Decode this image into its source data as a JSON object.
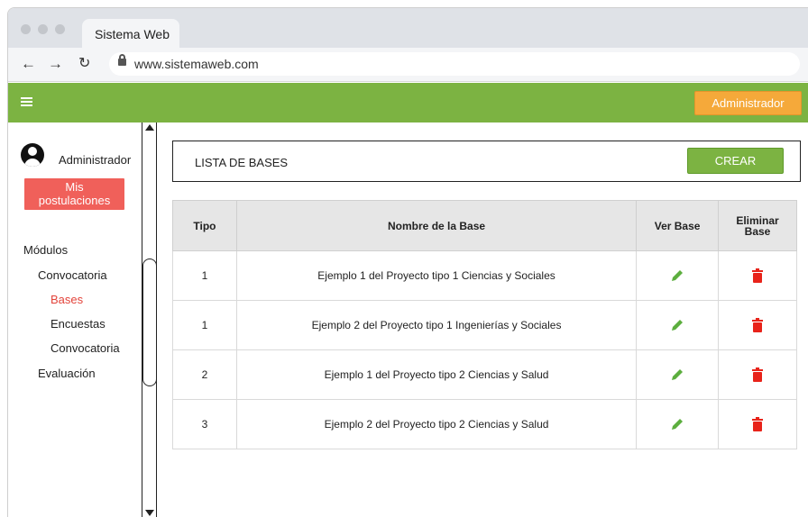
{
  "browser": {
    "tab_title": "Sistema Web",
    "url": "www.sistemaweb.com",
    "nav_icons": [
      "back-arrow-icon",
      "forward-arrow-icon",
      "reload-icon",
      "lock-icon"
    ]
  },
  "header": {
    "menu_icon": "hamburger-menu-icon",
    "admin_button": "Administrador",
    "accent_color": "#7cb342",
    "admin_button_color": "#f5a93a"
  },
  "sidebar": {
    "user_name": "Administrador",
    "avatar_icon": "user-avatar-icon",
    "mis_postulaciones_line1": "Mis",
    "mis_postulaciones_line2": "postulaciones",
    "modules_label": "Módulos",
    "items": [
      {
        "label": "Convocatoria"
      },
      {
        "label": "Bases",
        "active": true
      },
      {
        "label": "Encuestas"
      },
      {
        "label": "Convocatoria"
      },
      {
        "label": "Evaluación"
      }
    ]
  },
  "main": {
    "list_title": "LISTA DE BASES",
    "create_button": "CREAR",
    "table": {
      "headers": {
        "tipo": "Tipo",
        "nombre": "Nombre de la Base",
        "ver": "Ver Base",
        "eliminar_line1": "Eliminar",
        "eliminar_line2": "Base"
      },
      "rows": [
        {
          "tipo": "1",
          "nombre": "Ejemplo 1 del Proyecto tipo 1 Ciencias y Sociales"
        },
        {
          "tipo": "1",
          "nombre": "Ejemplo 2 del Proyecto tipo 1 Ingenierías y Sociales"
        },
        {
          "tipo": "2",
          "nombre": "Ejemplo 1 del Proyecto tipo 2 Ciencias y Salud"
        },
        {
          "tipo": "3",
          "nombre": "Ejemplo 2 del Proyecto tipo 2 Ciencias y Salud"
        }
      ],
      "edit_icon": "pencil-edit-icon",
      "delete_icon": "trash-delete-icon",
      "edit_color": "#5cae3e",
      "delete_color": "#e8231a"
    }
  }
}
